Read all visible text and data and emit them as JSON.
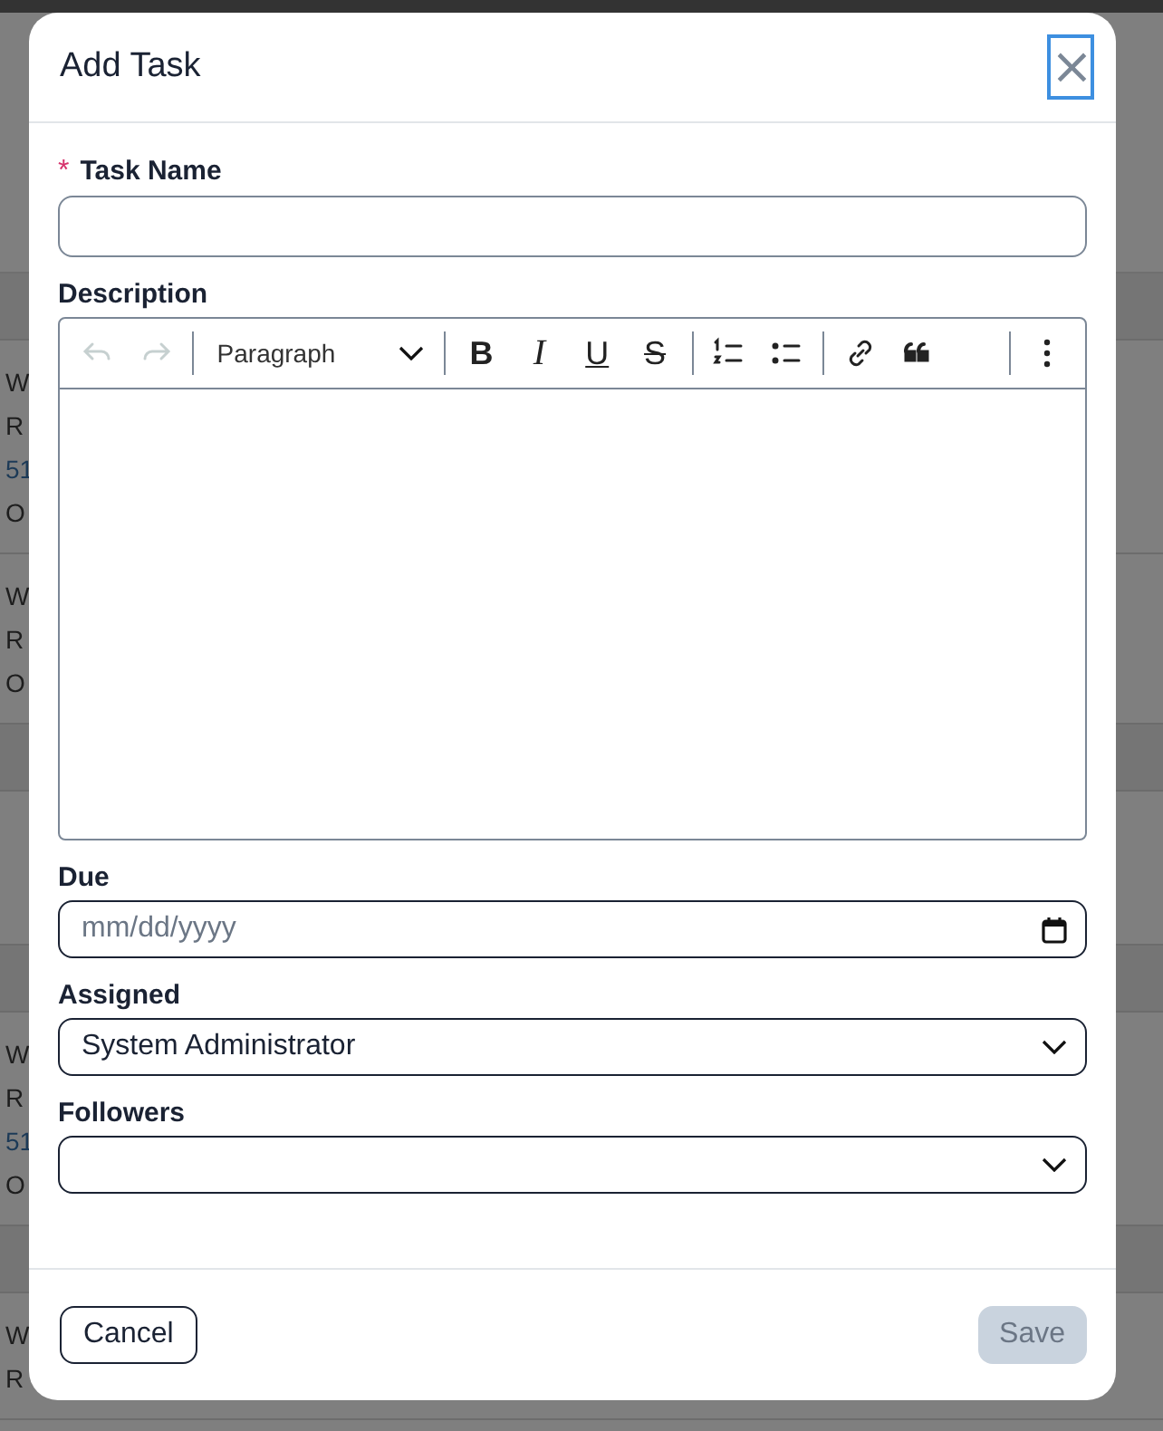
{
  "background": {
    "entries": [
      {
        "kind": "band"
      },
      {
        "kind": "entry",
        "lines": [
          {
            "text": "W",
            "link": false
          },
          {
            "text": "R",
            "link": false
          },
          {
            "text": "51",
            "link": true
          },
          {
            "text": "O",
            "link": false
          }
        ]
      },
      {
        "kind": "entry",
        "lines": [
          {
            "text": "W",
            "link": false
          },
          {
            "text": "R",
            "link": false
          },
          {
            "text": "O",
            "link": false
          }
        ]
      },
      {
        "kind": "band"
      },
      {
        "kind": "gap"
      },
      {
        "kind": "band"
      },
      {
        "kind": "entry",
        "lines": [
          {
            "text": "W",
            "link": false
          },
          {
            "text": "R",
            "link": false
          },
          {
            "text": "51",
            "link": true
          },
          {
            "text": "O",
            "link": false
          }
        ]
      },
      {
        "kind": "band"
      },
      {
        "kind": "entry",
        "lines": [
          {
            "text": "W",
            "link": false
          },
          {
            "text": "R",
            "link": false
          }
        ]
      }
    ]
  },
  "dialog": {
    "title": "Add Task",
    "required_marker": "*",
    "close_button": {
      "glyph": "×",
      "focused": true
    },
    "fields": [
      {
        "kind": "text",
        "label": "Task Name",
        "required": true
      },
      {
        "kind": "editor",
        "label": "Description",
        "required": false,
        "toolbar": [
          {
            "kind": "undo",
            "disabled": true
          },
          {
            "kind": "redo",
            "disabled": true
          },
          {
            "kind": "divider"
          },
          {
            "kind": "block-format",
            "text": "Paragraph"
          },
          {
            "kind": "divider"
          },
          {
            "kind": "bold",
            "glyph": "B"
          },
          {
            "kind": "italic",
            "glyph": "I"
          },
          {
            "kind": "underline",
            "glyph": "U"
          },
          {
            "kind": "strike",
            "glyph": "S"
          },
          {
            "kind": "divider"
          },
          {
            "kind": "ordered-list"
          },
          {
            "kind": "bullet-list"
          },
          {
            "kind": "divider"
          },
          {
            "kind": "link"
          },
          {
            "kind": "quote"
          },
          {
            "kind": "spacer"
          },
          {
            "kind": "divider"
          },
          {
            "kind": "more"
          }
        ]
      },
      {
        "kind": "date",
        "label": "Due",
        "required": false,
        "placeholder": "mm/dd/yyyy"
      },
      {
        "kind": "select",
        "label": "Assigned",
        "required": false,
        "value": "System Administrator"
      },
      {
        "kind": "select",
        "label": "Followers",
        "required": false
      }
    ],
    "buttons": [
      {
        "kind": "secondary",
        "label": "Cancel",
        "disabled": false
      },
      {
        "kind": "primary",
        "label": "Save",
        "disabled": true
      }
    ]
  }
}
